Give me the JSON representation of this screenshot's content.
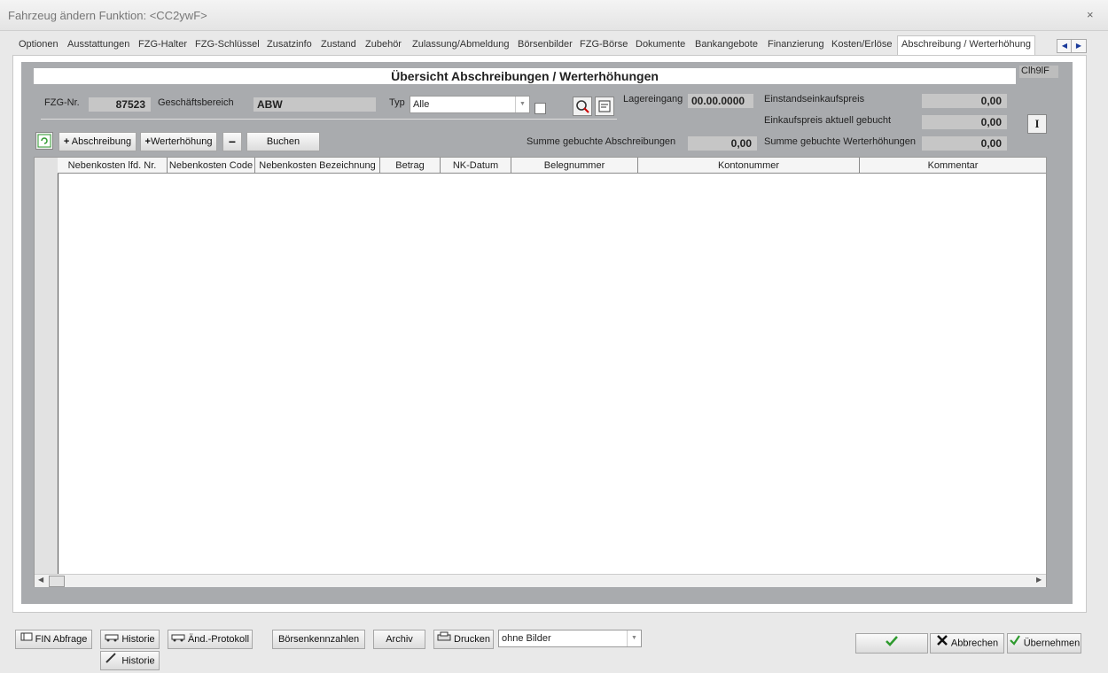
{
  "window": {
    "title": "Fahrzeug ändern   Funktion: <CC2ywF>",
    "close_symbol": "×"
  },
  "tabs": [
    {
      "label": "Optionen"
    },
    {
      "label": "Ausstattungen"
    },
    {
      "label": "FZG-Halter"
    },
    {
      "label": "FZG-Schlüssel"
    },
    {
      "label": "Zusatzinfo"
    },
    {
      "label": "Zustand"
    },
    {
      "label": "Zubehör"
    },
    {
      "label": "Zulassung/Abmeldung"
    },
    {
      "label": "Börsenbilder"
    },
    {
      "label": "FZG-Börse"
    },
    {
      "label": "Dokumente"
    },
    {
      "label": "Bankangebote"
    },
    {
      "label": "Finanzierung"
    },
    {
      "label": "Kosten/Erlöse"
    },
    {
      "label": "Abschreibung / Werterhöhung"
    }
  ],
  "active_tab": "Abschreibung / Werterhöhung",
  "tab_nav": {
    "prev": "◀",
    "next": "▶"
  },
  "heading": "Übersicht Abschreibungen / Werterhöhungen",
  "code_field": "Clh9lF",
  "fields": {
    "fzg_nr_label": "FZG-Nr.",
    "fzg_nr_value": "87523",
    "geschaeftsbereich_label": "Geschäftsbereich",
    "geschaeftsbereich_value": "ABW",
    "typ_label": "Typ",
    "typ_value": "Alle",
    "lagereingang_label": "Lagereingang",
    "lagereingang_value": "00.00.0000",
    "einstandseinkaufspreis_label": "Einstandseinkaufspreis",
    "einstandseinkaufspreis_value": "0,00",
    "einkaufspreis_label": "Einkaufspreis aktuell gebucht",
    "einkaufspreis_value": "0,00",
    "summe_abschreibungen_label": "Summe gebuchte Abschreibungen",
    "summe_abschreibungen_value": "0,00",
    "summe_werterhoehungen_label": "Summe gebuchte Werterhöhungen",
    "summe_werterhoehungen_value": "0,00"
  },
  "toolbar": {
    "abschreibung": "Abschreibung",
    "werterhoehung": "Werterhöhung",
    "minus": "−",
    "buchen": "Buchen",
    "plus": "+",
    "info_button": "I"
  },
  "table": {
    "columns": [
      "Nebenkosten lfd. Nr.",
      "Nebenkosten Code",
      "Nebenkosten Bezeichnung",
      "Betrag",
      "NK-Datum",
      "Belegnummer",
      "Kontonummer",
      "Kommentar"
    ],
    "rows": []
  },
  "bottom": {
    "fin_abfrage": "FIN Abfrage",
    "historie": "Historie",
    "aend_protokoll": "Änd.-Protokoll",
    "historie2": "Historie",
    "boersenkennzahlen": "Börsenkennzahlen",
    "archiv": "Archiv",
    "drucken": "Drucken",
    "bilder_option": "ohne Bilder",
    "ok": "OK",
    "abbrechen": "Abbrechen",
    "uebernehmen": "Übernehmen"
  },
  "colors": {
    "panel": "#a9abae",
    "readonly": "#c6c6c6",
    "accent_green": "#2e9a2e"
  }
}
